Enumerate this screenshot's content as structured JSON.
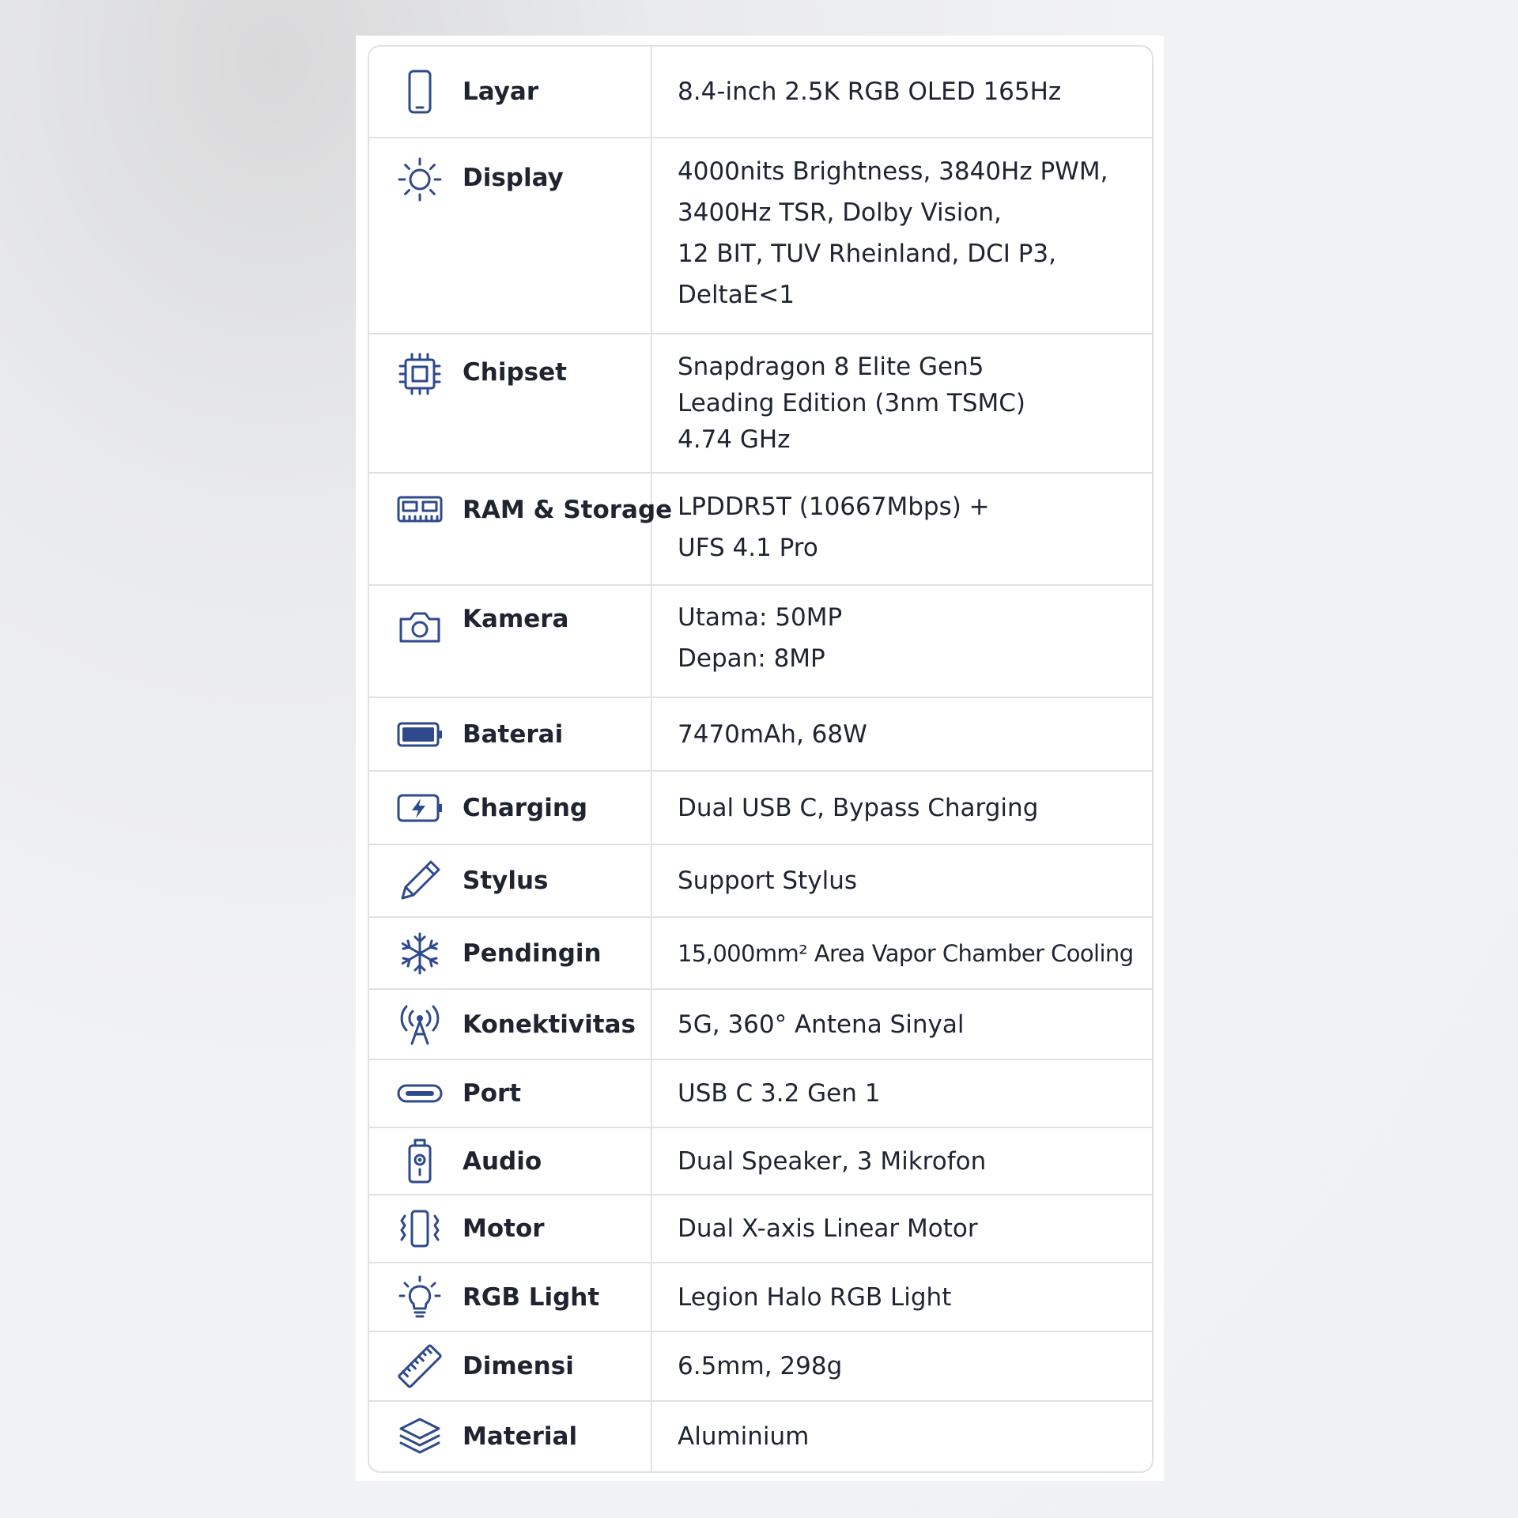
{
  "specs": [
    {
      "icon": "phone-icon",
      "label": "Layar",
      "value": "8.4-inch 2.5K RGB OLED 165Hz"
    },
    {
      "icon": "sun-icon",
      "label": "Display",
      "value": "4000nits Brightness, 3840Hz PWM,\n3400Hz TSR, Dolby Vision,\n12 BIT, TUV Rheinland, DCI P3,\nDeltaE<1"
    },
    {
      "icon": "chip-icon",
      "label": "Chipset",
      "value": "Snapdragon 8 Elite Gen5\nLeading Edition (3nm TSMC)\n4.74 GHz"
    },
    {
      "icon": "memory-icon",
      "label": "RAM & Storage",
      "value": "LPDDR5T (10667Mbps) +\nUFS 4.1 Pro"
    },
    {
      "icon": "camera-icon",
      "label": "Kamera",
      "value": "Utama: 50MP\nDepan: 8MP"
    },
    {
      "icon": "battery-icon",
      "label": "Baterai",
      "value": "7470mAh, 68W"
    },
    {
      "icon": "charging-icon",
      "label": "Charging",
      "value": "Dual USB C, Bypass Charging"
    },
    {
      "icon": "pencil-icon",
      "label": "Stylus",
      "value": "Support Stylus"
    },
    {
      "icon": "snowflake-icon",
      "label": "Pendingin",
      "value": "15,000mm² Area Vapor Chamber Cooling"
    },
    {
      "icon": "antenna-icon",
      "label": "Konektivitas",
      "value": "5G, 360° Antena Sinyal"
    },
    {
      "icon": "usb-port-icon",
      "label": "Port",
      "value": "USB C 3.2 Gen 1"
    },
    {
      "icon": "speaker-icon",
      "label": "Audio",
      "value": "Dual Speaker, 3 Mikrofon"
    },
    {
      "icon": "vibration-icon",
      "label": "Motor",
      "value": "Dual X-axis Linear Motor"
    },
    {
      "icon": "lightbulb-icon",
      "label": "RGB Light",
      "value": "Legion Halo RGB Light"
    },
    {
      "icon": "ruler-icon",
      "label": "Dimensi",
      "value": "6.5mm, 298g"
    },
    {
      "icon": "layers-icon",
      "label": "Material",
      "value": "Aluminium"
    }
  ]
}
